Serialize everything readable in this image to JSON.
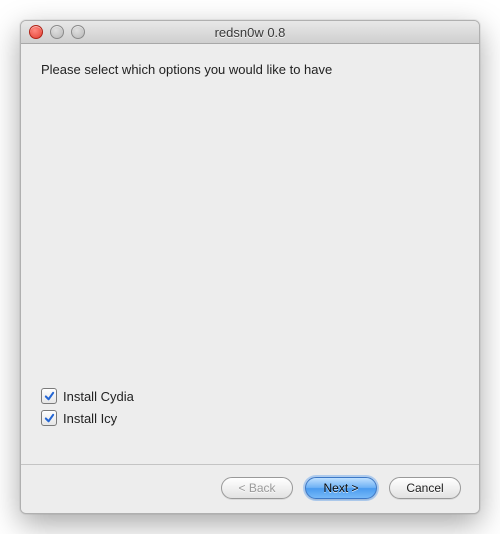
{
  "window": {
    "title": "redsn0w 0.8"
  },
  "instruction": "Please select which options you would like to have",
  "options": [
    {
      "label": "Install Cydia",
      "checked": true
    },
    {
      "label": "Install Icy",
      "checked": true
    }
  ],
  "buttons": {
    "back": "< Back",
    "next": "Next >",
    "cancel": "Cancel"
  }
}
